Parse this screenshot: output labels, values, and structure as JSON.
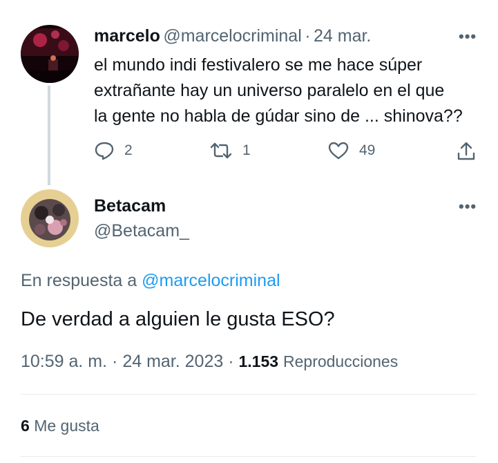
{
  "parent_tweet": {
    "display_name": "marcelo",
    "handle": "@marcelocriminal",
    "separator": "·",
    "date": "24 mar.",
    "more_label": "•••",
    "text_lines": [
      "el mundo indi festivalero se me hace súper",
      "extrañante hay un universo paralelo en el que",
      "la gente no habla de gúdar sino de ... shinova??"
    ],
    "replies": "2",
    "retweets": "1",
    "likes": "49"
  },
  "reply_tweet": {
    "display_name": "Betacam",
    "handle": "@Betacam_",
    "more_label": "•••",
    "in_reply_prefix": "En respuesta a",
    "in_reply_handle": "@marcelocriminal",
    "text": "De verdad a alguien le gusta ESO?",
    "time": "10:59 a. m.",
    "sep1": "·",
    "date": "24 mar. 2023",
    "sep2": "·",
    "views_count": "1.153",
    "views_label": "Reproducciones",
    "likes_count": "6",
    "likes_label": "Me gusta"
  },
  "colors": {
    "text": "#0f1419",
    "secondary": "#536471",
    "link": "#1d9bf0",
    "divider": "#e6ecf0"
  },
  "icons": [
    "reply-icon",
    "retweet-icon",
    "like-icon",
    "share-icon",
    "more-icon"
  ]
}
